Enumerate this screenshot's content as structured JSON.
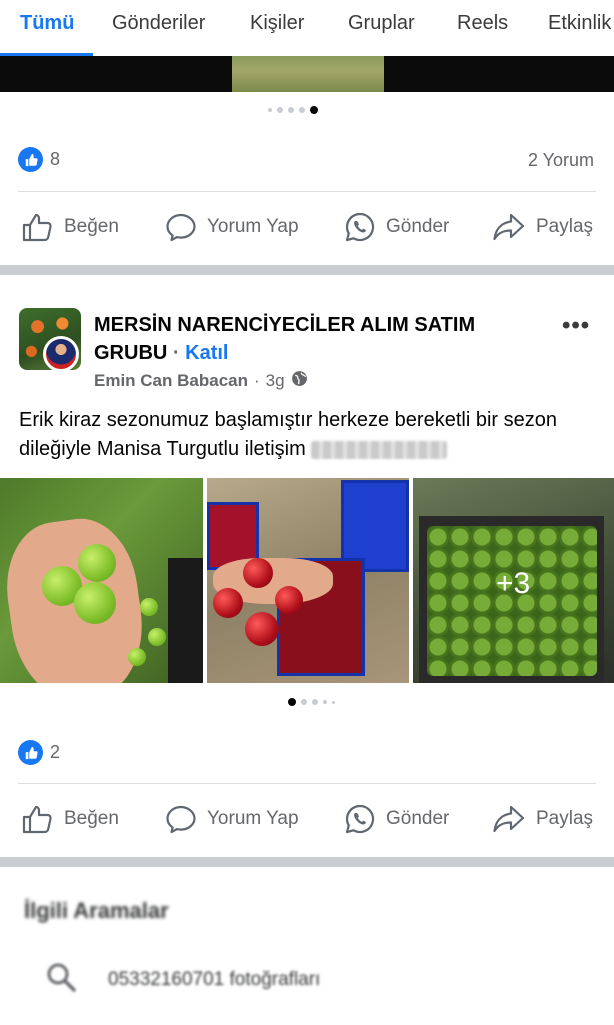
{
  "tabs": [
    {
      "label": "Tümü",
      "active": true
    },
    {
      "label": "Gönderiler"
    },
    {
      "label": "Kişiler"
    },
    {
      "label": "Gruplar"
    },
    {
      "label": "Reels"
    },
    {
      "label": "Etkinlik"
    }
  ],
  "previous_post": {
    "carousel_dots": {
      "count": 5,
      "active_index": 4
    },
    "likes_count": "8",
    "comments_text": "2 Yorum"
  },
  "actions": {
    "like": "Beğen",
    "comment": "Yorum Yap",
    "send": "Gönder",
    "share": "Paylaş"
  },
  "post": {
    "group_name": "MERSİN NARENCİYECİLER ALIM SATIM GRUBU",
    "separator": "·",
    "join_label": "Katıl",
    "author": "Emin Can Babacan",
    "time": "3g",
    "visibility_icon": "globe-icon",
    "text": "Erik kiraz sezonumuz başlamıştır herkeze bereketli bir sezon dileğiyle Manisa Turgutlu iletişim",
    "more_photos_label": "+3",
    "carousel_dots": {
      "count": 5,
      "active_index": 0
    },
    "likes_count": "2"
  },
  "related_searches": {
    "title": "İlgili Aramalar",
    "items": [
      {
        "icon": "search-icon",
        "text": "05332160701 fotoğrafları"
      }
    ]
  },
  "colors": {
    "accent": "#1877f2",
    "text_secondary": "#65676b",
    "separator": "#c9ccd1"
  }
}
